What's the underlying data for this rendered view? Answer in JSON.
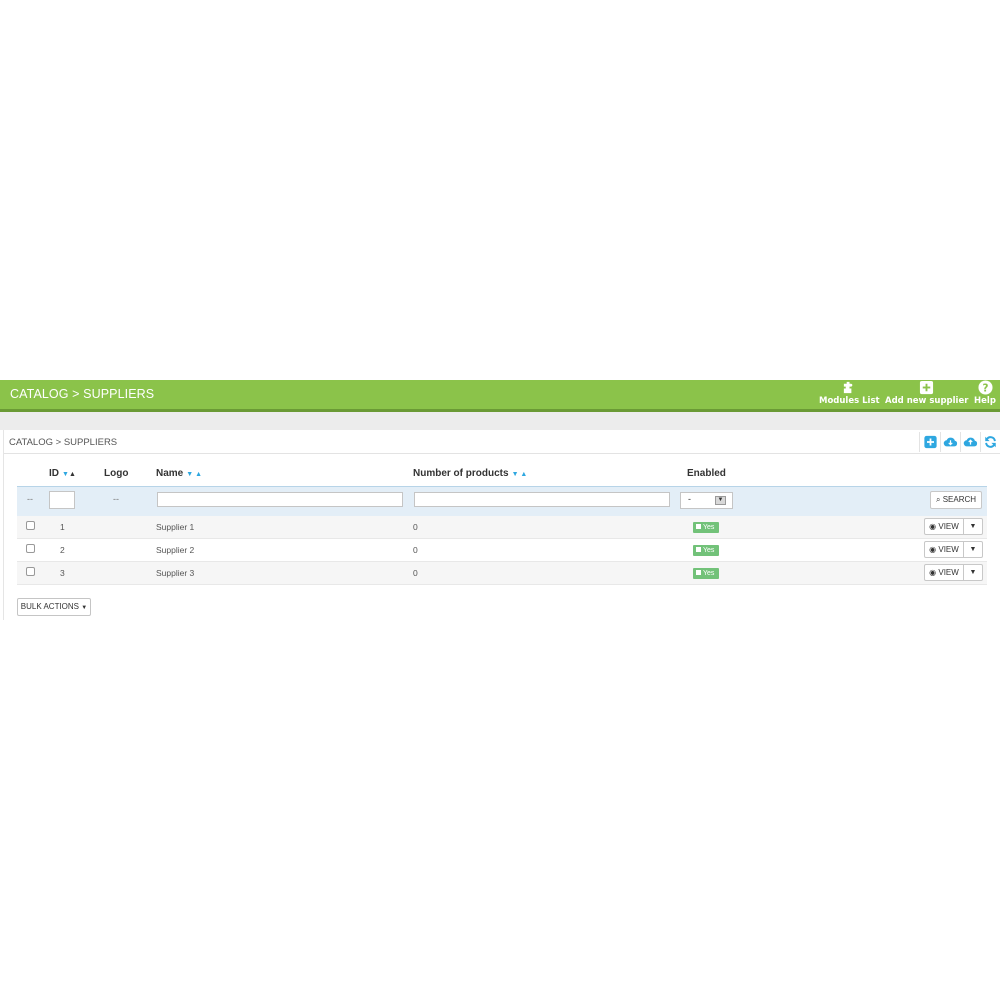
{
  "header": {
    "title": "CATALOG > SUPPLIERS",
    "toolbar": [
      {
        "label": "Modules List",
        "icon": "puzzle-icon"
      },
      {
        "label": "Add new supplier",
        "icon": "add-icon"
      },
      {
        "label": "Help",
        "icon": "help-icon"
      }
    ],
    "color": "#8bc34a"
  },
  "panel": {
    "title": "CATALOG > SUPPLIERS",
    "icons": [
      "add-icon",
      "cloud-download-icon",
      "cloud-upload-icon",
      "refresh-icon"
    ]
  },
  "table": {
    "columns": [
      {
        "label": "ID",
        "sortable": true
      },
      {
        "label": "Logo",
        "sortable": false
      },
      {
        "label": "Name",
        "sortable": true
      },
      {
        "label": "Number of products",
        "sortable": true
      },
      {
        "label": "Enabled",
        "sortable": false
      }
    ],
    "filter": {
      "dash": "--",
      "logo_dash": "--",
      "enabled_select": "-",
      "search_label": "SEARCH"
    },
    "rows": [
      {
        "id": "1",
        "name": "Supplier 1",
        "products": "0",
        "enabled": "Yes",
        "action": "VIEW"
      },
      {
        "id": "2",
        "name": "Supplier 2",
        "products": "0",
        "enabled": "Yes",
        "action": "VIEW"
      },
      {
        "id": "3",
        "name": "Supplier 3",
        "products": "0",
        "enabled": "Yes",
        "action": "VIEW"
      }
    ]
  },
  "bulk_actions_label": "BULK ACTIONS",
  "colors": {
    "accent": "#2ea7e0",
    "enabled_badge": "#72c279"
  }
}
